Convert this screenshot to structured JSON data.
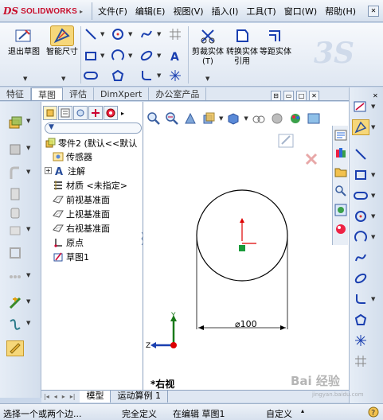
{
  "app": {
    "logo_mark": "DS",
    "logo_text": "SOLIDWORKS",
    "colors": {
      "brand": "#c8102e",
      "toolbar_bg": "#dfe7f2",
      "highlight": "#f6d77a",
      "sketch_blue": "#1a3fb0"
    }
  },
  "menu": {
    "items": [
      "文件(F)",
      "编辑(E)",
      "视图(V)",
      "插入(I)",
      "工具(T)",
      "窗口(W)",
      "帮助(H)"
    ],
    "pin_icon": "pin-icon"
  },
  "command_manager": {
    "exit_sketch_label": "退出草图",
    "smart_dimension_label": "智能尺寸",
    "trim_label": "剪裁实体(T)",
    "convert_label": "转换实体引用",
    "offset_label": "等距实体",
    "small_tools": [
      "line-icon",
      "circle-icon",
      "spline-icon",
      "rectangle-icon",
      "arc-icon",
      "ellipse-icon",
      "text-icon",
      "slot-icon",
      "polygon-icon",
      "fillet-icon",
      "point-icon",
      "grid-icon",
      "mirror-icon"
    ]
  },
  "tabs": [
    "特征",
    "草图",
    "评估",
    "DimXpert",
    "办公室产品"
  ],
  "active_tab": "草图",
  "tree": {
    "root": "零件2 (默认<<默认",
    "items": [
      {
        "label": "传感器",
        "icon": "sensor-icon"
      },
      {
        "label": "注解",
        "icon": "annotation-icon"
      },
      {
        "label": "材质 <未指定>",
        "icon": "material-icon"
      },
      {
        "label": "前视基准面",
        "icon": "plane-icon"
      },
      {
        "label": "上视基准面",
        "icon": "plane-icon"
      },
      {
        "label": "右视基准面",
        "icon": "plane-icon"
      },
      {
        "label": "原点",
        "icon": "origin-icon"
      },
      {
        "label": "草图1",
        "icon": "sketch-icon"
      }
    ]
  },
  "graphics": {
    "dimension_label": "⌀100",
    "view_label": "*右视",
    "triad_axes": [
      "Y",
      "Z"
    ]
  },
  "bottom_tabs": [
    "模型",
    "运动算例 1"
  ],
  "status": {
    "hint": "选择一个或两个边...",
    "definition": "完全定义",
    "editing": "在编辑 草图1",
    "units": "自定义"
  },
  "watermark": {
    "text": "Bai 经验",
    "sub": "jingyan.baidu.com"
  }
}
